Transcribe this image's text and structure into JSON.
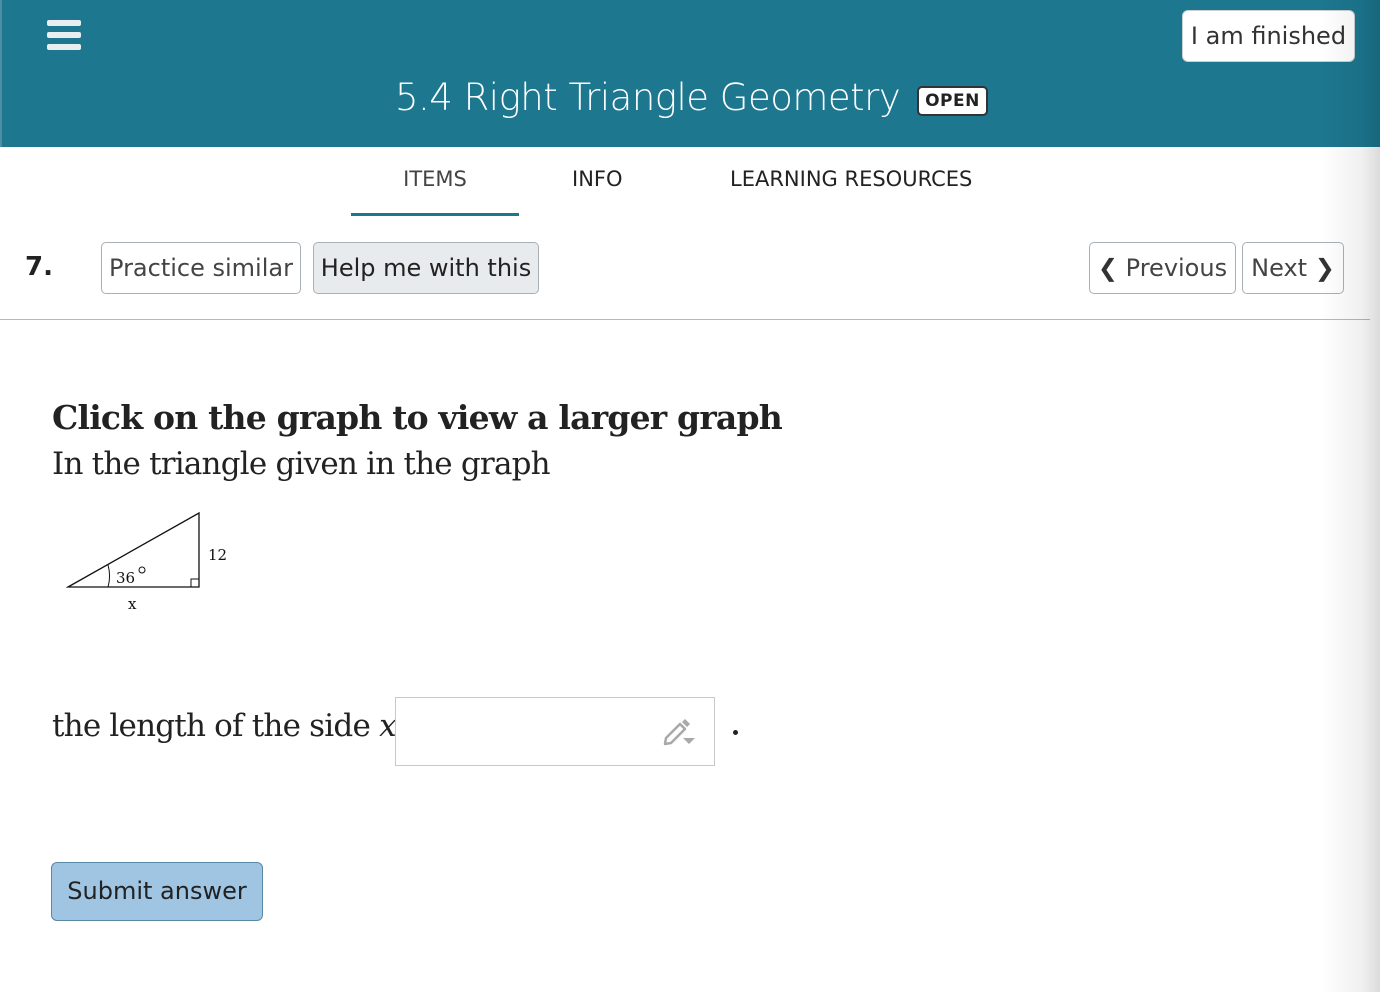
{
  "header": {
    "menu_icon": "hamburger-menu-icon",
    "title": "5.4 Right Triangle Geometry",
    "status_badge": "OPEN",
    "finish_button": "I am finished",
    "background_color": "#1c778f"
  },
  "tabs": [
    {
      "label": "ITEMS",
      "active": true
    },
    {
      "label": "INFO",
      "active": false
    },
    {
      "label": "LEARNING RESOURCES",
      "active": false
    }
  ],
  "question_bar": {
    "number": "7.",
    "practice_similar": "Practice similar",
    "help": "Help me with this",
    "previous": "Previous",
    "next": "Next",
    "previous_icon": "chevron-left-icon",
    "next_icon": "chevron-right-icon"
  },
  "question": {
    "instruction": "Click on the graph to view a larger graph",
    "prompt": "In the triangle given in the graph",
    "figure": {
      "angle_label": "36",
      "degree_symbol": "°",
      "opposite_label": "12",
      "adjacent_label": "x"
    },
    "answer_label_prefix": "the length of the side ",
    "answer_variable": "x",
    "answer_equals": " =",
    "answer_value": "",
    "answer_icon": "pencil-dropdown-icon",
    "trailing": "."
  },
  "submit": {
    "label": "Submit answer",
    "color": "#9fc5e2"
  }
}
